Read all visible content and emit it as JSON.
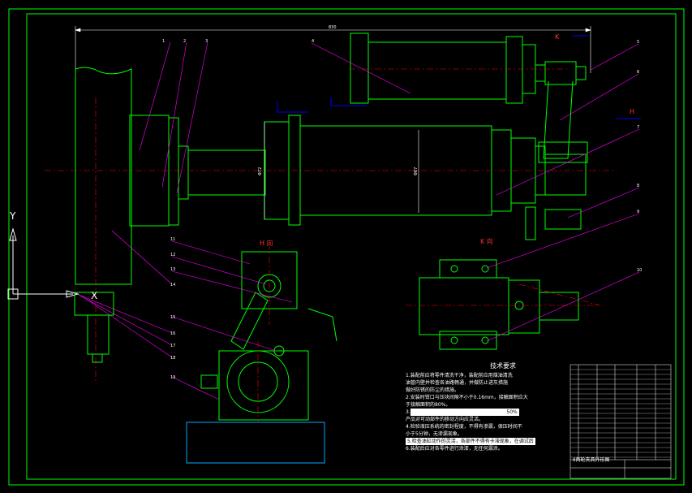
{
  "drawing": {
    "title": "II两轮夹具外形图",
    "view_labels": {
      "k_top": "K",
      "h_right": "H",
      "h_mid": "H 向",
      "k_mid": "K 向"
    },
    "dimension_top": "830",
    "dimension_left": "Φ72",
    "dimension_center": "Φ87",
    "part_numbers": [
      "1",
      "2",
      "3",
      "4",
      "5",
      "6",
      "7",
      "8",
      "9",
      "10",
      "11",
      "12",
      "13",
      "14",
      "15",
      "16",
      "17",
      "18",
      "19"
    ],
    "ucs": {
      "y_label": "Y",
      "x_label": "X"
    }
  },
  "notes": {
    "title": "技术要求",
    "lines": [
      "1.装配前应将零件清洗干净，装配前应用煤油清洗",
      "油管内壁并检查各油路畅通，并做防止进灰措施",
      "做好防锈的防尘的措施。",
      "2.安装时钳口与压块间隙不小于0.16mm，接触面积应大",
      "于接触面积的80%。",
      "3.",
      "产品对可动部件的移动方向应灵活。",
      "4.检验液压系统的密封程度，不得有渗漏，保压时间不",
      "小于5分钟，无渗漏现象。",
      "5.检查油缸动作的灵活，各部件不得有卡滞现象，在调试后",
      "6.装配后应对各零件进行涂漆，无任何漏涂。"
    ],
    "highlight_value": "50%"
  },
  "colors": {
    "border": "#00ff00",
    "part_line": "#00ff00",
    "center_line": "#ff0000",
    "leader": "#ff00ff",
    "hidden": "#0000ff",
    "frame": "#00ff00",
    "text": "#ffffff",
    "yellow": "#ffff00"
  }
}
